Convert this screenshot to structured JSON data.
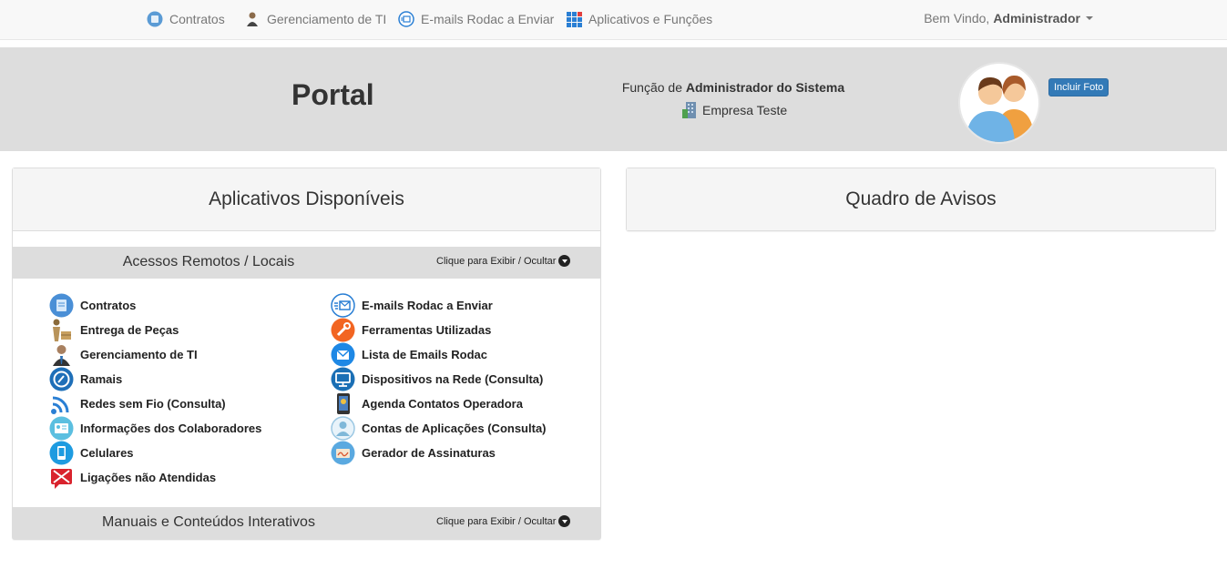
{
  "nav": {
    "items": [
      {
        "label": "Contratos",
        "icon": "contracts-icon"
      },
      {
        "label": "Gerenciamento de TI",
        "icon": "it-manager-icon"
      },
      {
        "label": "E-mails Rodac a Enviar",
        "icon": "email-send-icon"
      },
      {
        "label": "Aplicativos e Funções",
        "icon": "apps-grid-icon"
      }
    ],
    "welcome": "Bem Vindo,",
    "user": "Administrador"
  },
  "header": {
    "title": "Portal",
    "function_prefix": "Função de",
    "function_name": "Administrador do Sistema",
    "company": "Empresa Teste",
    "photo_button": "Incluir Foto"
  },
  "apps_panel": {
    "title": "Aplicativos Disponíveis",
    "sections": [
      {
        "title": "Acessos Remotos / Locais",
        "toggle": "Clique para Exibir / Ocultar",
        "left": [
          {
            "label": "Contratos",
            "icon": "contracts-icon",
            "color": "#4a8fd6"
          },
          {
            "label": "Entrega de Peças",
            "icon": "delivery-icon",
            "color": "#8a6a3a"
          },
          {
            "label": "Gerenciamento de TI",
            "icon": "it-manager-icon",
            "color": "#555555"
          },
          {
            "label": "Ramais",
            "icon": "phone-icon",
            "color": "#1e6fb8"
          },
          {
            "label": "Redes sem Fio (Consulta)",
            "icon": "wifi-icon",
            "color": "#2a7fd4"
          },
          {
            "label": "Informações dos Colaboradores",
            "icon": "id-card-icon",
            "color": "#5bbfe0"
          },
          {
            "label": "Celulares",
            "icon": "mobile-icon",
            "color": "#1e9be0"
          },
          {
            "label": "Ligações não Atendidas",
            "icon": "missed-call-icon",
            "color": "#d9232d"
          }
        ],
        "right": [
          {
            "label": "E-mails Rodac a Enviar",
            "icon": "email-send-icon",
            "color": "#2a7fd4"
          },
          {
            "label": "Ferramentas Utilizadas",
            "icon": "tools-icon",
            "color": "#f26522"
          },
          {
            "label": "Lista de Emails Rodac",
            "icon": "email-list-icon",
            "color": "#1e88e5"
          },
          {
            "label": "Dispositivos na Rede (Consulta)",
            "icon": "network-device-icon",
            "color": "#1a6fb5"
          },
          {
            "label": "Agenda Contatos Operadora",
            "icon": "contacts-book-icon",
            "color": "#333333"
          },
          {
            "label": "Contas de Aplicações (Consulta)",
            "icon": "user-account-icon",
            "color": "#7fb8d9"
          },
          {
            "label": "Gerador de Assinaturas",
            "icon": "signature-icon",
            "color": "#5aa9e0"
          }
        ]
      },
      {
        "title": "Manuais e Conteúdos Interativos",
        "toggle": "Clique para Exibir / Ocultar"
      }
    ]
  },
  "notices_panel": {
    "title": "Quadro de Avisos"
  }
}
